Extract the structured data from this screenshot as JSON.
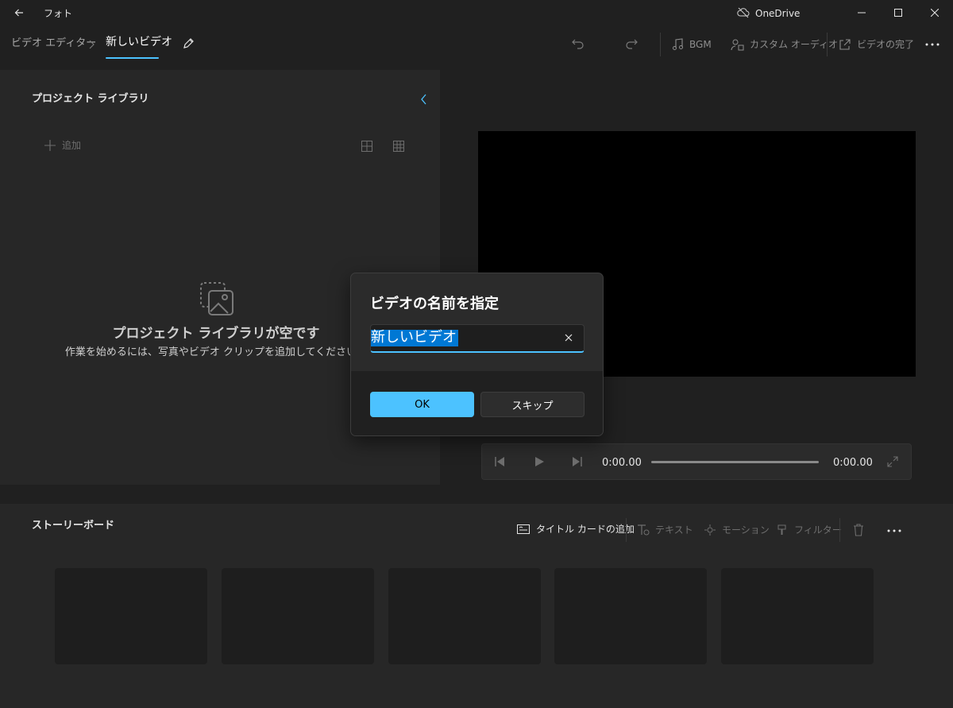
{
  "titlebar": {
    "app_name": "フォト",
    "onedrive_label": "OneDrive",
    "icons": [
      "back-arrow-icon",
      "cloud-off-icon",
      "minimize-icon",
      "maximize-icon",
      "close-icon"
    ]
  },
  "header": {
    "breadcrumb_parent": "ビデオ エディター",
    "breadcrumb_current": "新しいビデオ",
    "bgm_label": "BGM",
    "custom_audio_label": "カスタム オーディオ",
    "finish_video_label": "ビデオの完了"
  },
  "library": {
    "title": "プロジェクト ライブラリ",
    "add_label": "追加",
    "empty_title": "プロジェクト ライブラリが空です",
    "empty_subtitle": "作業を始めるには、写真やビデオ クリップを追加してください。"
  },
  "player": {
    "current_time": "0:00.00",
    "total_time": "0:00.00"
  },
  "storyboard": {
    "title": "ストーリーボード",
    "add_title_card_label": "タイトル カードの追加",
    "text_label": "テキスト",
    "motion_label": "モーション",
    "filter_label": "フィルター",
    "slot_count_visible": 5
  },
  "dialog": {
    "title": "ビデオの名前を指定",
    "input_value": "新しいビデオ",
    "ok_label": "OK",
    "skip_label": "スキップ"
  },
  "colors": {
    "background": "#202020",
    "panel": "#272727",
    "accent": "#4cc2ff",
    "selection": "#0078d4"
  }
}
